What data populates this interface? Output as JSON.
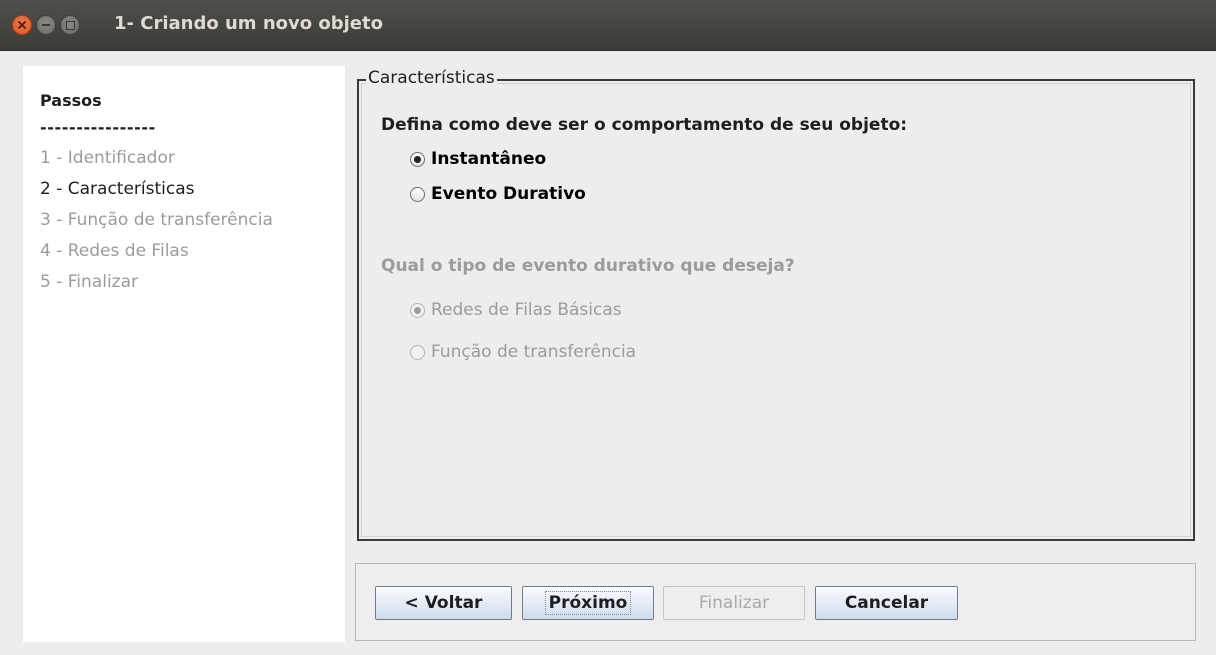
{
  "window": {
    "title": "1- Criando um novo objeto"
  },
  "steps": {
    "heading": "Passos",
    "separator": "----------------",
    "items": [
      {
        "label": "1 - Identificador",
        "active": false
      },
      {
        "label": "2 - Características",
        "active": true
      },
      {
        "label": "3 - Função de transferência",
        "active": false
      },
      {
        "label": "4 - Redes de Filas",
        "active": false
      },
      {
        "label": "5 - Finalizar",
        "active": false
      }
    ]
  },
  "panel": {
    "legend": "Características",
    "behavior_question": "Defina como deve ser o comportamento de seu objeto:",
    "behavior_options": [
      {
        "label": "Instantâneo",
        "selected": true,
        "enabled": true
      },
      {
        "label": "Evento Durativo",
        "selected": false,
        "enabled": true
      }
    ],
    "event_question": "Qual o tipo de evento durativo que deseja?",
    "event_options": [
      {
        "label": "Redes de Filas Básicas",
        "selected": true,
        "enabled": false
      },
      {
        "label": "Função de transferência",
        "selected": false,
        "enabled": false
      }
    ]
  },
  "buttons": {
    "back": "< Voltar",
    "next": "Próximo",
    "finish": "Finalizar",
    "cancel": "Cancelar"
  },
  "colors": {
    "close_button": "#e0562a",
    "titlebar": "#3c3b37",
    "disabled_text": "#9b9b9b"
  }
}
